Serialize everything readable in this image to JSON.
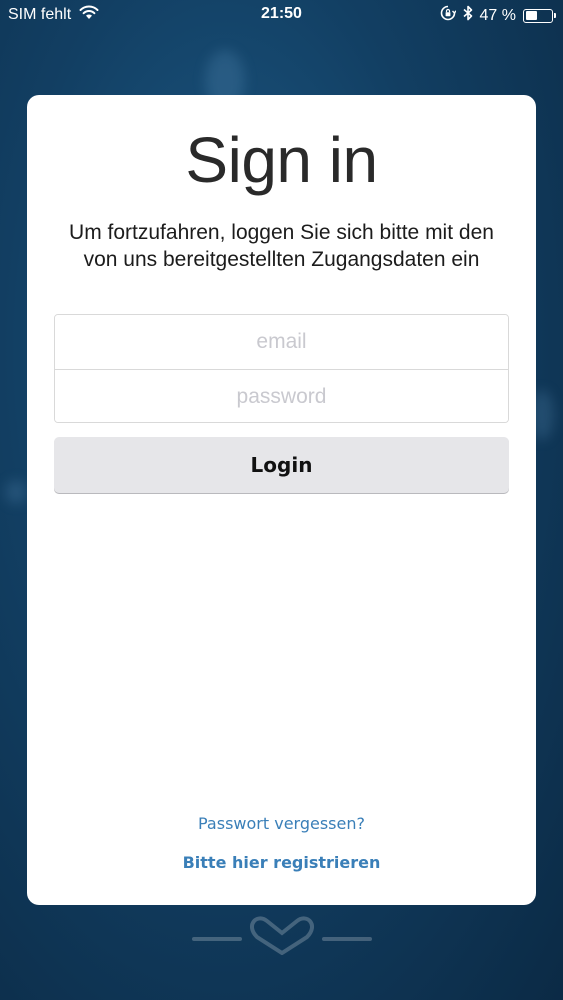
{
  "status_bar": {
    "carrier": "SIM fehlt",
    "time": "21:50",
    "battery_percent": "47 %",
    "battery_level": 0.47,
    "icons": [
      "wifi-icon",
      "orientation-lock-icon",
      "bluetooth-icon",
      "battery-icon"
    ]
  },
  "login": {
    "title": "Sign in",
    "subtitle": "Um fortzufahren, loggen Sie sich bitte mit den von uns bereitgestellten Zugangsdaten ein",
    "email_placeholder": "email",
    "password_placeholder": "password",
    "login_label": "Login",
    "forgot_password": "Passwort vergessen?",
    "register": "Bitte hier registrieren"
  },
  "colors": {
    "background": "#123f63",
    "card": "#ffffff",
    "link": "#3a7fb8",
    "button": "#e6e6e9"
  }
}
